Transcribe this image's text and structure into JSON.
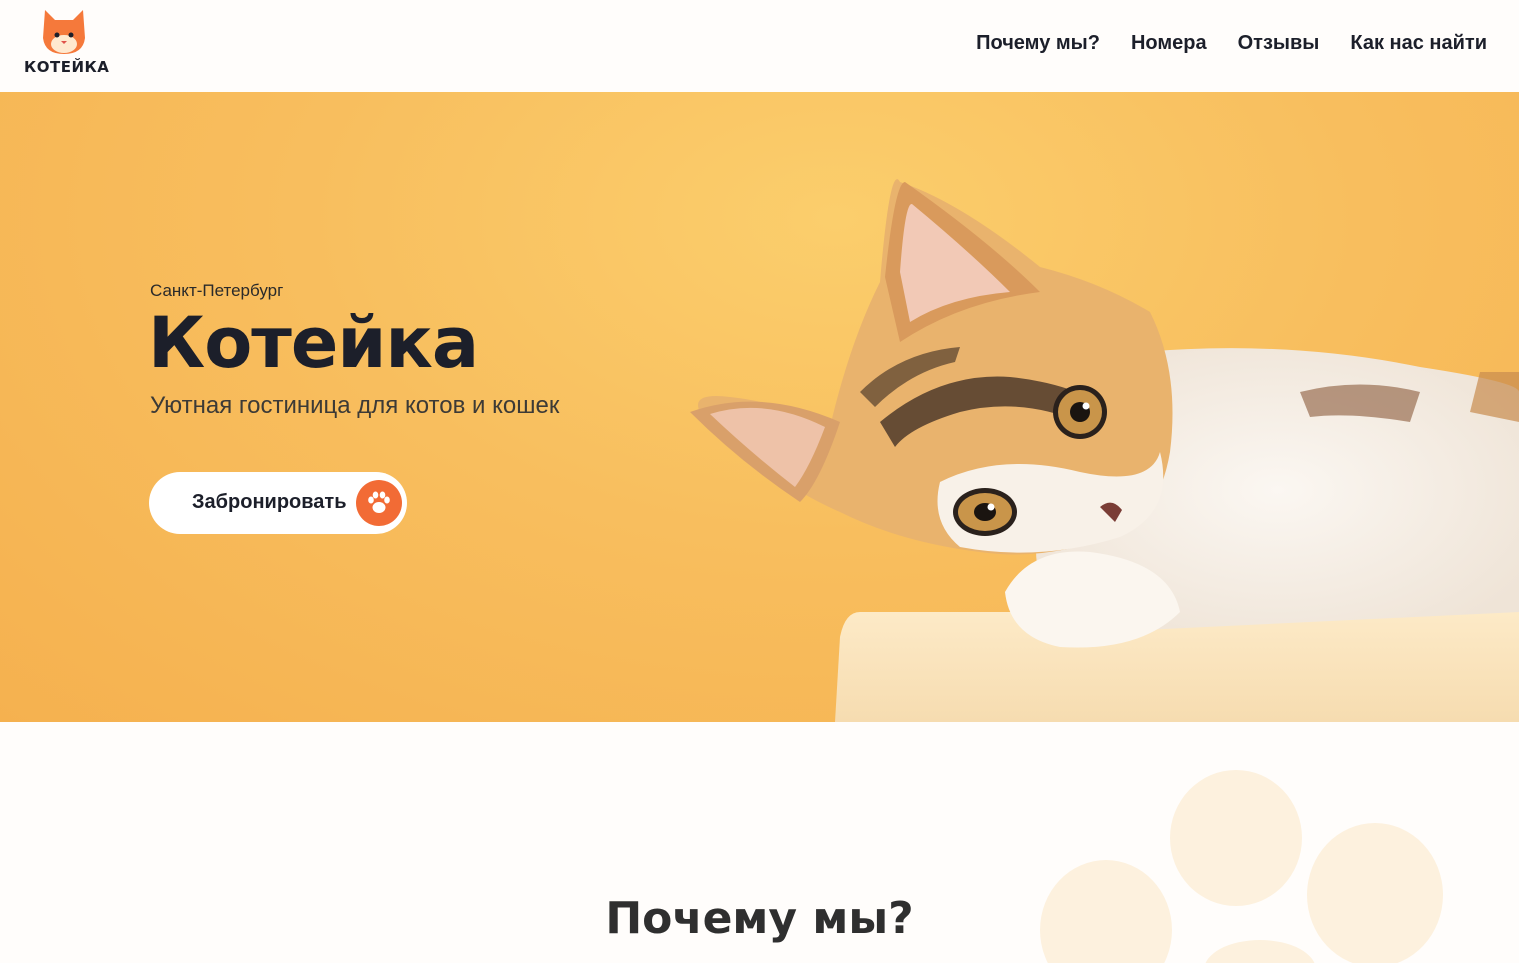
{
  "logo": {
    "text": "КОТЕЙКА",
    "icon": "cat-head-icon"
  },
  "nav": {
    "items": [
      "Почему мы?",
      "Номера",
      "Отзывы",
      "Как нас найти"
    ]
  },
  "hero": {
    "city": "Санкт-Петербург",
    "title": "Котейка",
    "subtitle": "Уютная гостиница для котов и кошек",
    "button_label": "Забронировать",
    "button_icon": "paw-icon",
    "image": "kitten-photo",
    "colors": {
      "background": "#f8be5e",
      "accent": "#f26b35"
    }
  },
  "why": {
    "title": "Почему мы?",
    "decor_icon": "paw-icon"
  }
}
